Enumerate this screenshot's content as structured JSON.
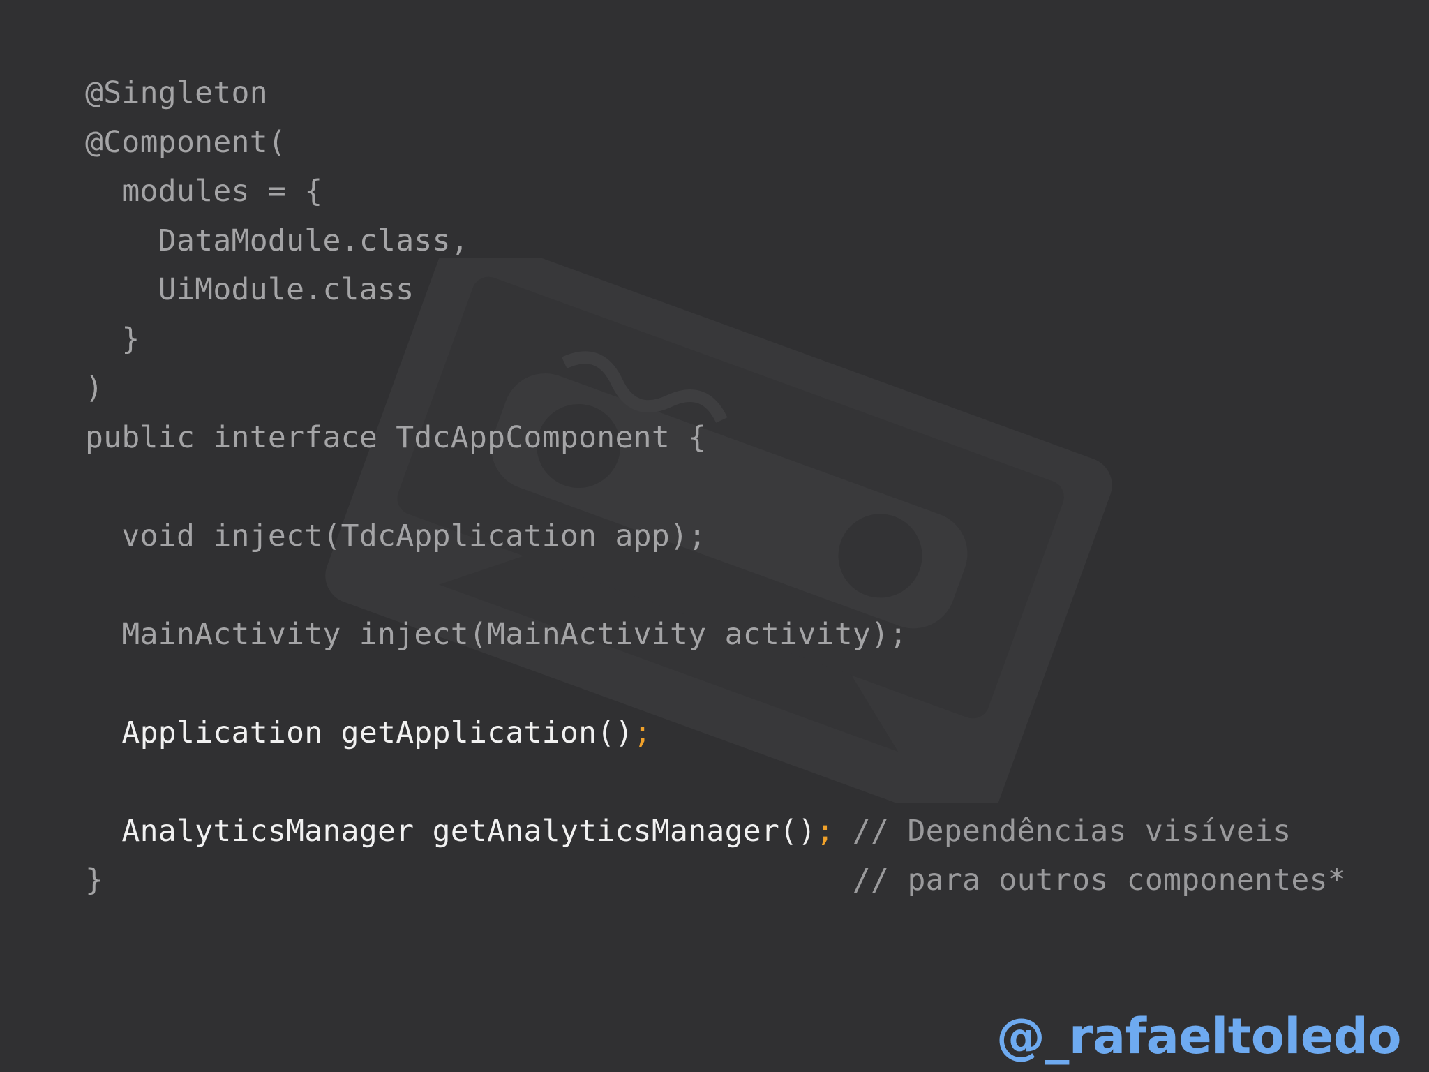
{
  "slide": {
    "background": "#303032",
    "watermark_icon": "cassette-tape-icon",
    "code_lines": [
      {
        "parts": [
          "@Singleton"
        ]
      },
      {
        "parts": [
          "@Component("
        ]
      },
      {
        "parts": [
          "  modules = {"
        ]
      },
      {
        "parts": [
          "    DataModule.class,"
        ]
      },
      {
        "parts": [
          "    UiModule.class"
        ]
      },
      {
        "parts": [
          "  }"
        ]
      },
      {
        "parts": [
          ")"
        ]
      },
      {
        "parts": [
          "public interface TdcAppComponent {"
        ]
      },
      {
        "parts": [
          ""
        ]
      },
      {
        "parts": [
          "  void inject(TdcApplication app);"
        ]
      },
      {
        "parts": [
          ""
        ]
      },
      {
        "parts": [
          "  MainActivity inject(MainActivity activity);"
        ]
      },
      {
        "parts": [
          ""
        ]
      },
      {
        "parts": [
          "  Application getApplication()",
          ";"
        ]
      },
      {
        "parts": [
          ""
        ]
      },
      {
        "parts": [
          "  AnalyticsManager getAnalyticsManager()",
          ";",
          " // Dependências visíveis"
        ]
      },
      {
        "parts": [
          "}",
          "                                         // para outros componentes*"
        ]
      }
    ],
    "colors": {
      "dim_code": "#a4a4a6",
      "highlight_code": "#f1f1f1",
      "semicolon_accent": "#f0a12a",
      "comment": "#9a9a9c",
      "handle": "#6eaaf0"
    },
    "author_handle": "@_rafaeltoledo"
  }
}
